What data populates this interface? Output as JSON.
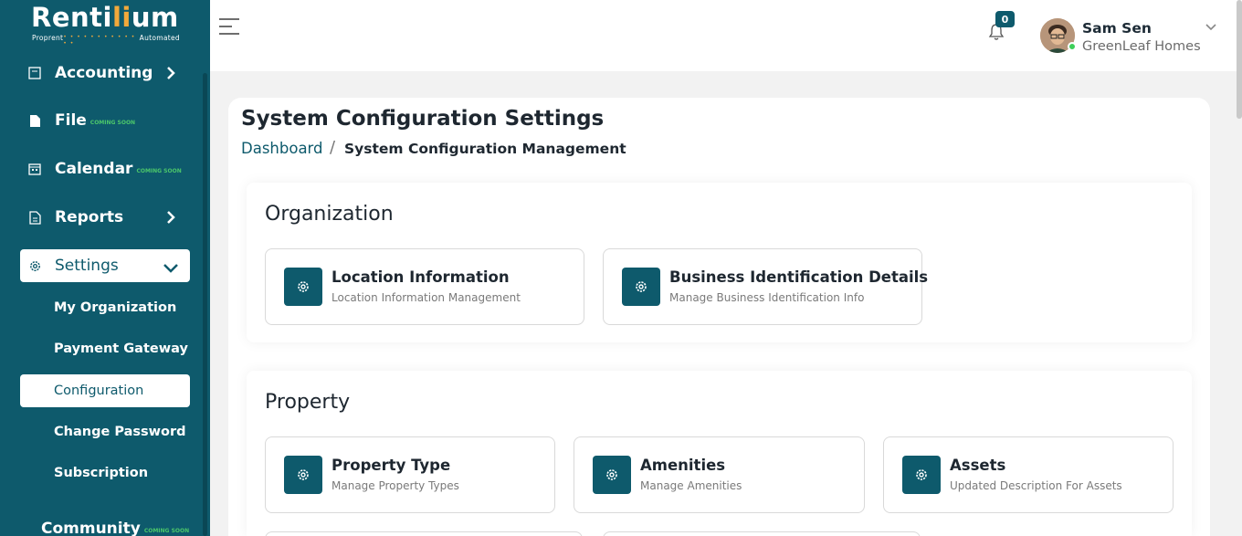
{
  "brand": {
    "logo_main": "Renti",
    "logo_accent": "li",
    "logo_end": "um",
    "tag_left": "Proprent",
    "tag_dots": "• • • • • • • • • • • • •",
    "tag_right": "Automated"
  },
  "sidebar": {
    "items": [
      {
        "label": "Accounting",
        "icon": "accounting-icon"
      },
      {
        "label": "File",
        "soon": "COMING SOON",
        "icon": "file-icon"
      },
      {
        "label": "Calendar",
        "soon": "COMING SOON",
        "icon": "calendar-icon"
      },
      {
        "label": "Reports",
        "icon": "reports-icon"
      },
      {
        "label": "Settings",
        "icon": "gear-icon"
      }
    ],
    "sub_items": [
      {
        "label": "My Organization"
      },
      {
        "label": "Payment Gateway"
      },
      {
        "label": "Configuration"
      },
      {
        "label": "Change Password"
      },
      {
        "label": "Subscription"
      }
    ],
    "community": {
      "label": "Community",
      "soon": "COMING SOON"
    }
  },
  "header": {
    "notification_count": "0",
    "user_name": "Sam Sen",
    "user_company": "GreenLeaf Homes"
  },
  "page": {
    "title": "System Configuration Settings",
    "breadcrumb_link": "Dashboard",
    "breadcrumb_sep": "/",
    "breadcrumb_current": "System Configuration Management"
  },
  "sections": {
    "organization": {
      "title": "Organization",
      "cards": [
        {
          "title": "Location Information",
          "desc": "Location Information Management"
        },
        {
          "title": "Business Identification Details",
          "desc": "Manage Business Identification Info"
        }
      ]
    },
    "property": {
      "title": "Property",
      "cards": [
        {
          "title": "Property Type",
          "desc": "Manage Property Types"
        },
        {
          "title": "Amenities",
          "desc": "Manage Amenities"
        },
        {
          "title": "Assets",
          "desc": "Updated Description For Assets"
        }
      ]
    }
  },
  "colors": {
    "primary": "#0e5a6c",
    "accent": "#f2a93b",
    "coming_soon": "#4cc76b"
  }
}
